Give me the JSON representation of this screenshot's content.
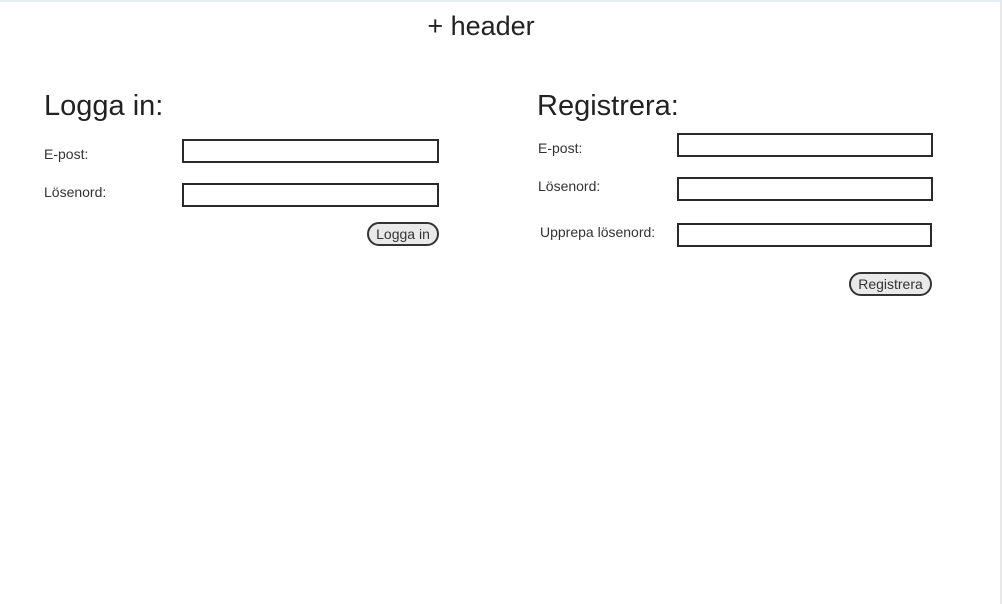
{
  "header": {
    "title": "+ header"
  },
  "login": {
    "title": "Logga in:",
    "email_label": "E-post:",
    "email_value": "",
    "password_label": "Lösenord:",
    "password_value": "",
    "submit_label": "Logga in"
  },
  "register": {
    "title": "Registrera:",
    "email_label": "E-post:",
    "email_value": "",
    "password_label": "Lösenord:",
    "password_value": "",
    "repeat_password_label": "Upprepa lösenord:",
    "repeat_password_value": "",
    "submit_label": "Registrera"
  }
}
